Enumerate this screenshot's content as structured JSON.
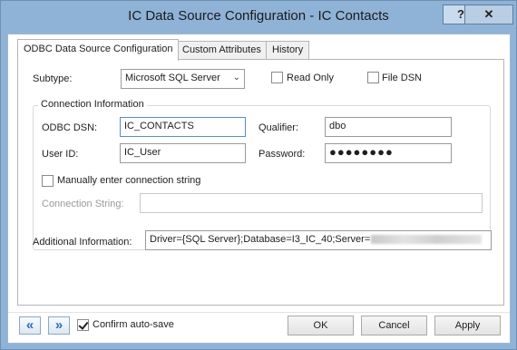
{
  "window": {
    "title": "IC Data Source Configuration - IC Contacts"
  },
  "titlebar": {
    "help_glyph": "?",
    "close_glyph": "✕"
  },
  "tabs": [
    {
      "label": "ODBC Data Source Configuration",
      "active": true
    },
    {
      "label": "Custom Attributes",
      "active": false
    },
    {
      "label": "History",
      "active": false
    }
  ],
  "form": {
    "subtype_label": "Subtype:",
    "subtype_value": "Microsoft SQL Server",
    "read_only_label": "Read Only",
    "read_only_checked": false,
    "file_dsn_label": "File DSN",
    "file_dsn_checked": false,
    "connection_group_title": "Connection Information",
    "odbc_dsn_label": "ODBC DSN:",
    "odbc_dsn_value": "IC_CONTACTS",
    "qualifier_label": "Qualifier:",
    "qualifier_value": "dbo",
    "user_id_label": "User ID:",
    "user_id_value": "IC_User",
    "password_label": "Password:",
    "password_value": "●●●●●●●●",
    "manual_conn_label": "Manually enter connection string",
    "manual_conn_checked": false,
    "conn_string_label": "Connection String:",
    "conn_string_value": "",
    "additional_info_label": "Additional Information:",
    "additional_info_value": "Driver={SQL Server};Database=I3_IC_40;Server="
  },
  "footer": {
    "prev_glyph": "«",
    "next_glyph": "»",
    "confirm_autosave_label": "Confirm auto-save",
    "confirm_autosave_checked": true,
    "ok_label": "OK",
    "cancel_label": "Cancel",
    "apply_label": "Apply"
  }
}
